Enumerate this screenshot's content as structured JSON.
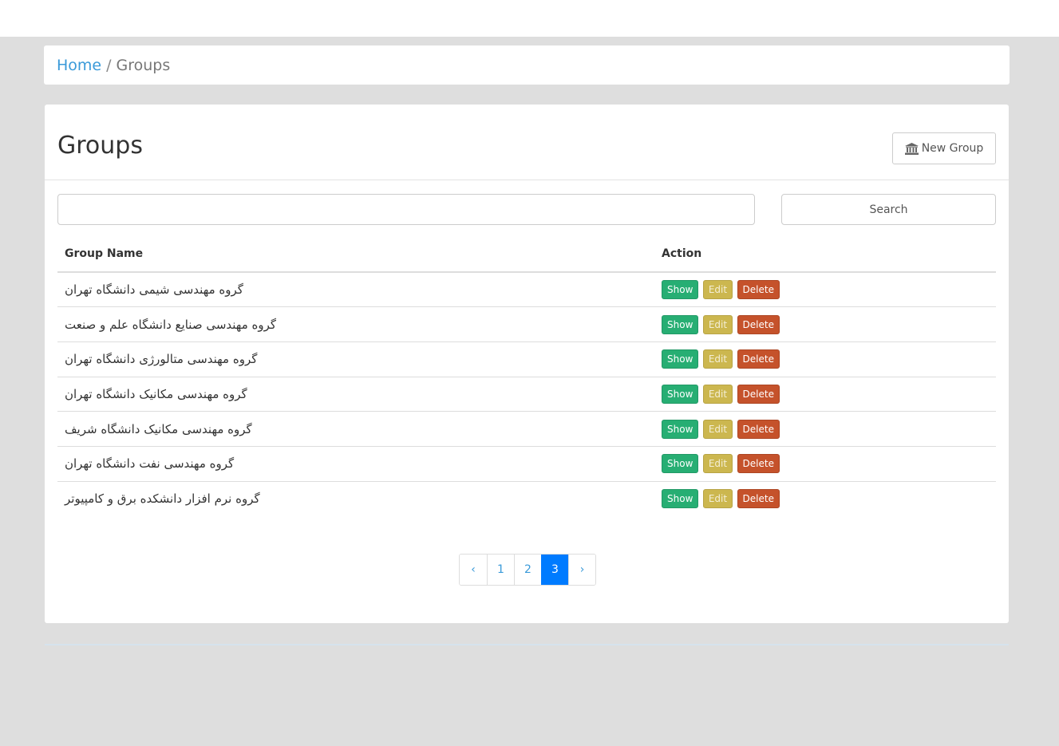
{
  "breadcrumb": {
    "home": "Home",
    "separator": "/",
    "current": "Groups"
  },
  "page": {
    "title": "Groups",
    "new_button": "New Group",
    "new_button_icon": "bank-icon"
  },
  "search": {
    "placeholder": "",
    "value": "",
    "button": "Search"
  },
  "table": {
    "headers": {
      "name": "Group Name",
      "action": "Action"
    },
    "actions": {
      "show": "Show",
      "edit": "Edit",
      "delete": "Delete"
    },
    "rows": [
      {
        "name": "گروه مهندسی شیمی دانشگاه تهران"
      },
      {
        "name": "گروه مهندسی صنایع دانشگاه علم و صنعت"
      },
      {
        "name": "گروه مهندسی متالورژی دانشگاه تهران"
      },
      {
        "name": "گروه مهندسی مکانیک دانشگاه تهران"
      },
      {
        "name": "گروه مهندسی مکانیک دانشگاه شریف"
      },
      {
        "name": "گروه مهندسی نفت دانشگاه تهران"
      },
      {
        "name": "گروه نرم افزار دانشکده برق و کامپیوتر"
      }
    ]
  },
  "pagination": {
    "prev": "‹",
    "pages": [
      "1",
      "2",
      "3"
    ],
    "active": "3",
    "next": "›"
  },
  "colors": {
    "show": "#27ae73",
    "edit": "#ccb74f",
    "delete": "#c5522b",
    "link": "#3a9ad9",
    "active_page": "#007bff"
  }
}
